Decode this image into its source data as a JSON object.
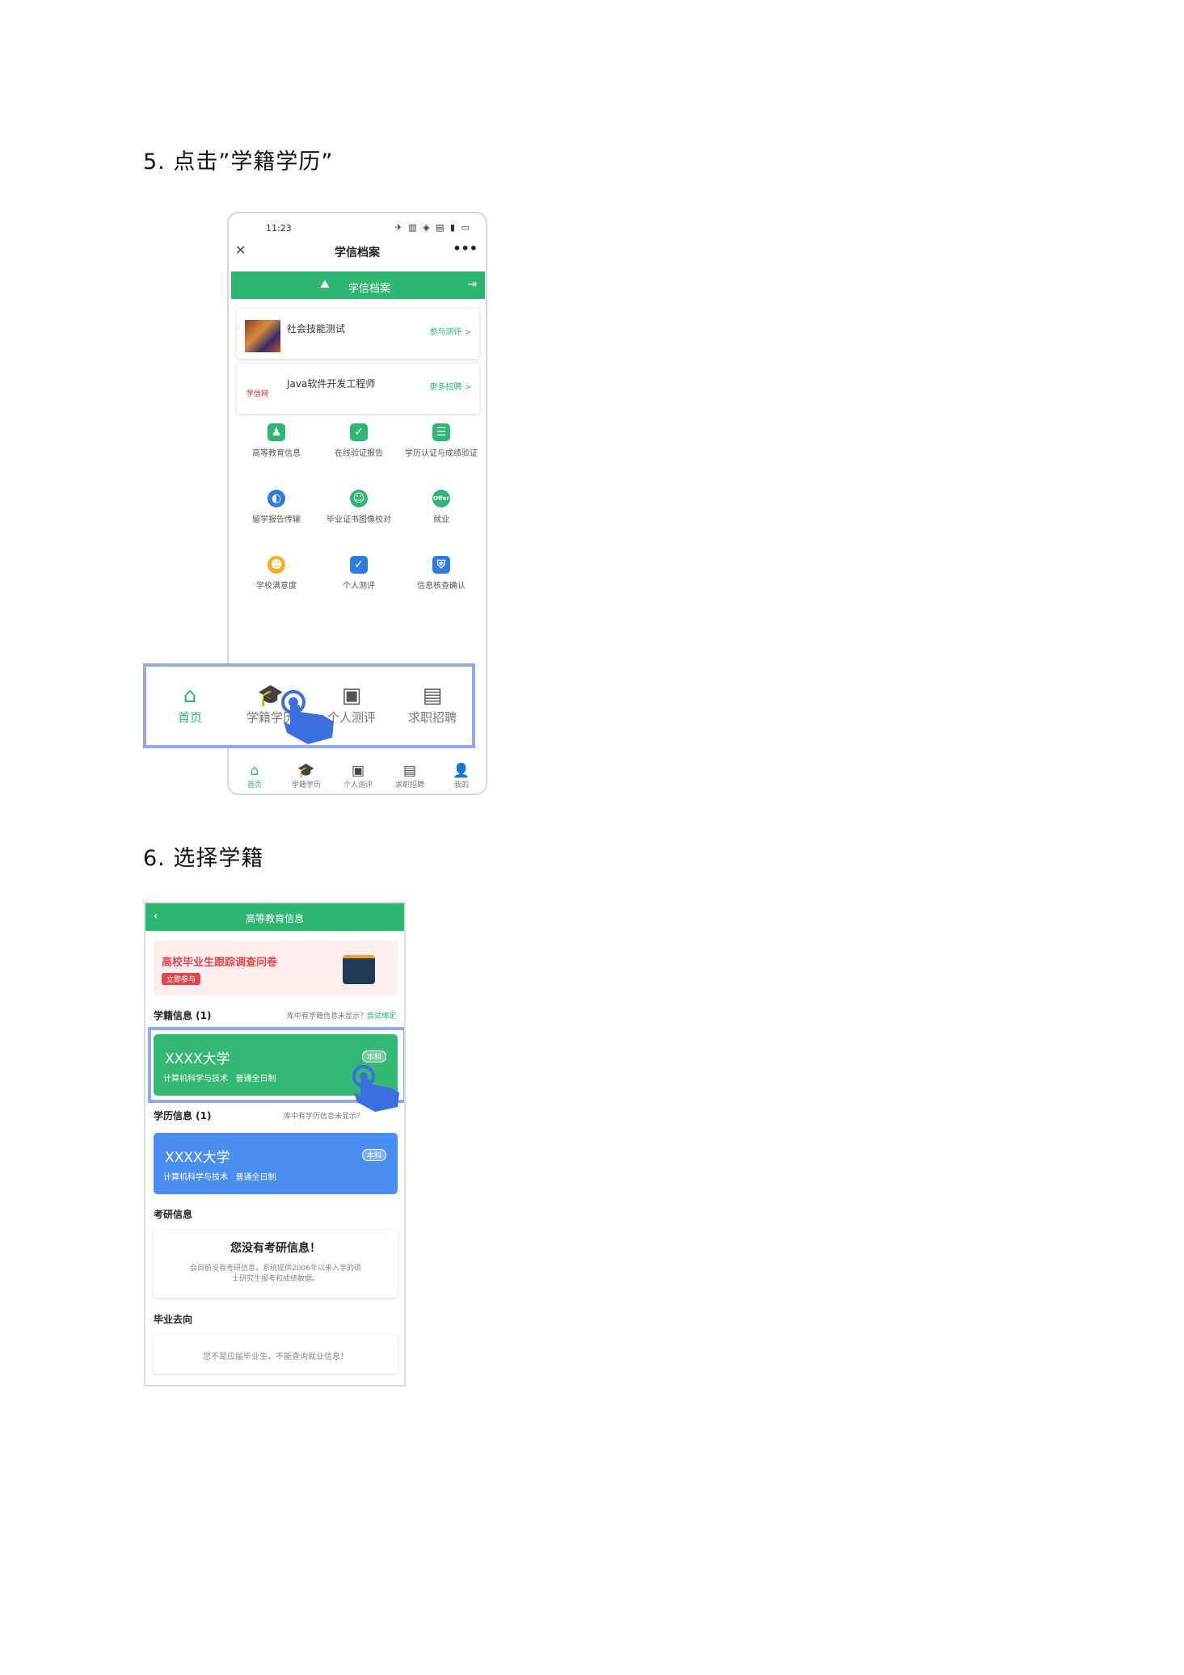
{
  "steps": {
    "step5": "5.   点击”学籍学历”",
    "step6": "6.   选择学籍"
  },
  "phone1": {
    "time": "11:23",
    "status_icons": "✈ ▥ ◈ ▤ ▮ ▭",
    "title": "学信档案",
    "brand": "学信档案",
    "cards": [
      {
        "title": "社会技能测试",
        "link": "参与测评 >"
      },
      {
        "title": "Java软件开发工程师",
        "link": "更多招聘 >",
        "logo": "学信网"
      }
    ],
    "grid": [
      {
        "label": "高等教育信息",
        "icon": "graduate-icon",
        "color": "#2fb673"
      },
      {
        "label": "在线验证报告",
        "icon": "shield-check-icon",
        "color": "#2fb673"
      },
      {
        "label": "学历认证与成绩验证",
        "icon": "id-card-icon",
        "color": "#2fb673"
      },
      {
        "label": "留学报告传输",
        "icon": "globe-icon",
        "color": "#2f7be0"
      },
      {
        "label": "毕业证书图像校对",
        "icon": "user-check-icon",
        "color": "#2fb673"
      },
      {
        "label": "就业",
        "icon": "offer-icon",
        "color": "#2fb673"
      },
      {
        "label": "学校满意度",
        "icon": "smile-icon",
        "color": "#f0b020"
      },
      {
        "label": "个人测评",
        "icon": "clipboard-check-icon",
        "color": "#2f7be0"
      },
      {
        "label": "信息核查确认",
        "icon": "user-shield-icon",
        "color": "#2f7be0"
      }
    ],
    "bottom_nav": [
      "首页",
      "学籍学历",
      "个人测评",
      "求职招聘",
      "我的"
    ],
    "callout_nav": [
      "首页",
      "学籍学历",
      "个人测评",
      "求职招聘"
    ],
    "accent": "#2fb673",
    "highlight": "#8fa8ee"
  },
  "phone2": {
    "title": "高等教育信息",
    "banner_title": "高校毕业生跟踪调查问卷",
    "banner_tag": "立即参与",
    "xueji_label": "学籍信息 (1)",
    "xueji_hint": "库中有学籍信息未显示？",
    "xueji_link": "尝试绑定",
    "xueji_card": {
      "name": "XXXX大学",
      "major": "计算机科学与技术",
      "type": "普通全日制",
      "level": "本科"
    },
    "xueli_label": "学历信息 (1)",
    "xueli_hint": "库中有学历信息未显示？",
    "xueli_card": {
      "name": "XXXX大学",
      "major": "计算机科学与技术",
      "type": "普通全日制",
      "level": "本科"
    },
    "kaoyan_label": "考研信息",
    "kaoyan_title": "您没有考研信息！",
    "kaoyan_desc1": "会目前没有考研信息，系统提供2006年以来入学的硕",
    "kaoyan_desc2": "士研究生报考和成绩数据。",
    "quxiang_label": "毕业去向",
    "quxiang_desc": "您不是应届毕业生，不能查询就业信息！"
  }
}
